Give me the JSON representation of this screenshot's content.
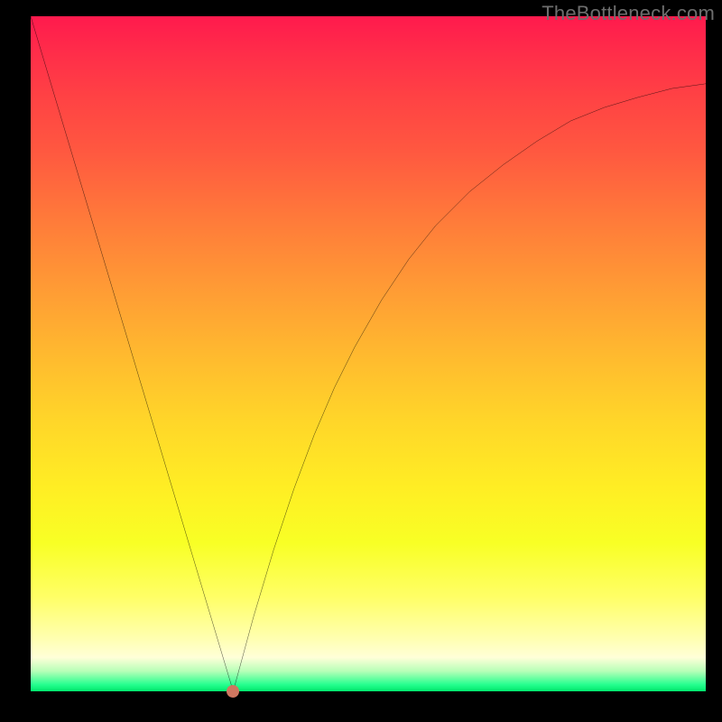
{
  "attribution": "TheBottleneck.com",
  "chart_data": {
    "type": "line",
    "title": "",
    "xlabel": "",
    "ylabel": "",
    "xlim": [
      0,
      100
    ],
    "ylim": [
      0,
      100
    ],
    "grid": false,
    "colors": {
      "background_gradient_top": "#ff1a4d",
      "background_gradient_bottom": "#00e86c",
      "curve": "#000000",
      "min_marker": "#cf7760",
      "frame": "#000000"
    },
    "min_point": {
      "x": 30,
      "y": 0
    },
    "series": [
      {
        "name": "bottleneck-curve",
        "x": [
          0,
          3,
          6,
          9,
          12,
          15,
          18,
          21,
          24,
          27,
          30,
          33,
          36,
          39,
          42,
          45,
          48,
          52,
          56,
          60,
          65,
          70,
          75,
          80,
          85,
          90,
          95,
          100
        ],
        "y": [
          100,
          90,
          80,
          70,
          60,
          50,
          40,
          30,
          20,
          10,
          0,
          11,
          21,
          30,
          38,
          45,
          51,
          58,
          64,
          69,
          74,
          78,
          81.5,
          84.5,
          86.5,
          88,
          89.3,
          90
        ]
      }
    ]
  }
}
